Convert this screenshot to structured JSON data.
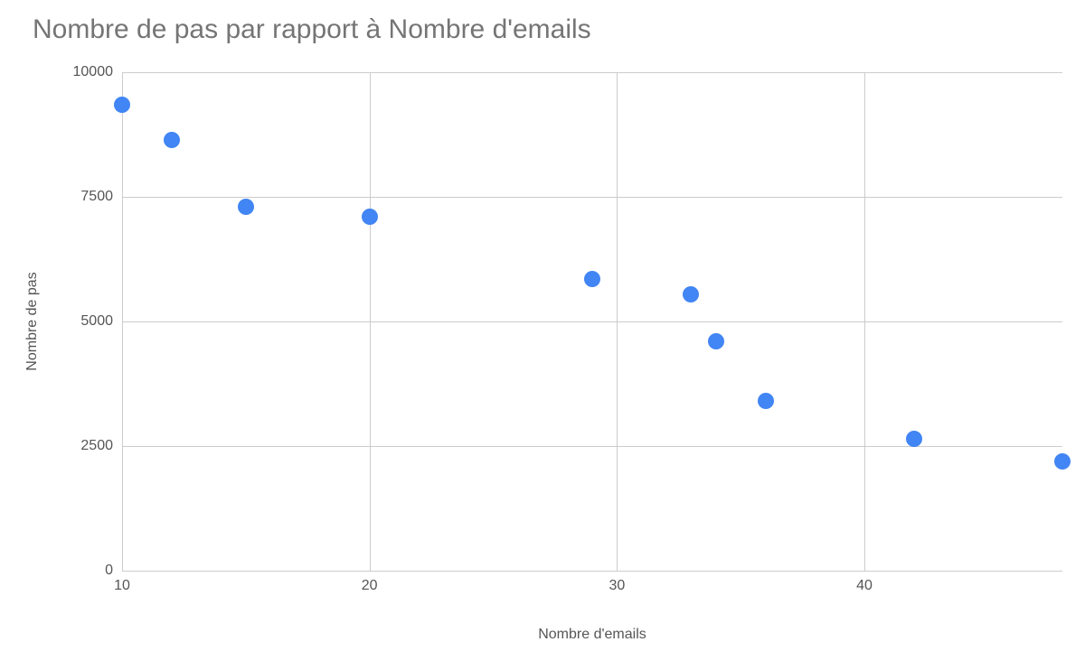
{
  "chart_data": {
    "type": "scatter",
    "title": "Nombre de pas par rapport à Nombre d'emails",
    "xlabel": "Nombre d'emails",
    "ylabel": "Nombre de pas",
    "xlim": [
      10,
      48
    ],
    "ylim": [
      0,
      10000
    ],
    "x_ticks": [
      10,
      20,
      30,
      40
    ],
    "y_ticks": [
      0,
      2500,
      5000,
      7500,
      10000
    ],
    "points": [
      {
        "x": 10,
        "y": 9350
      },
      {
        "x": 12,
        "y": 8650
      },
      {
        "x": 15,
        "y": 7300
      },
      {
        "x": 20,
        "y": 7100
      },
      {
        "x": 29,
        "y": 5850
      },
      {
        "x": 33,
        "y": 5550
      },
      {
        "x": 34,
        "y": 4600
      },
      {
        "x": 36,
        "y": 3400
      },
      {
        "x": 42,
        "y": 2650
      },
      {
        "x": 48,
        "y": 2200
      }
    ],
    "point_color": "#4285f4"
  }
}
